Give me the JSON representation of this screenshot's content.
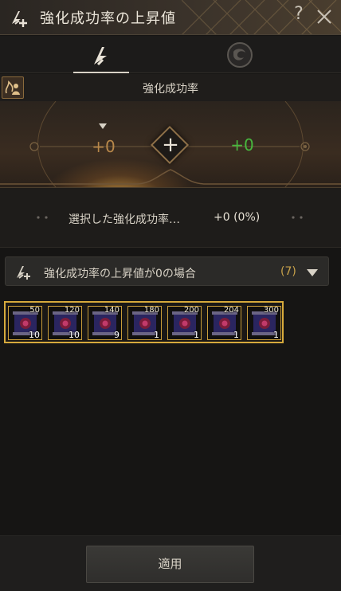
{
  "header": {
    "title": "強化成功率の上昇値",
    "help_label": "?"
  },
  "tabs": [
    {
      "icon": "arrow-up-icon",
      "active": true
    },
    {
      "icon": "swirl-orb-icon",
      "active": false
    }
  ],
  "panel": {
    "title": "強化成功率",
    "left_value": "+0",
    "right_value": "+0"
  },
  "summary": {
    "label": "選択した強化成功率…",
    "value": "+0 (0%)"
  },
  "filter": {
    "label": "強化成功率の上昇値が0の場合",
    "count": "(7)"
  },
  "items": [
    {
      "top": "50",
      "qty": "10"
    },
    {
      "top": "120",
      "qty": "10"
    },
    {
      "top": "140",
      "qty": "9"
    },
    {
      "top": "180",
      "qty": "1"
    },
    {
      "top": "200",
      "qty": "1"
    },
    {
      "top": "204",
      "qty": "1"
    },
    {
      "top": "300",
      "qty": "1"
    }
  ],
  "footer": {
    "apply_label": "適用"
  },
  "colors": {
    "accent_gold": "#d6aa3c",
    "positive_green": "#47b83e",
    "neutral_value": "#b8884a"
  }
}
